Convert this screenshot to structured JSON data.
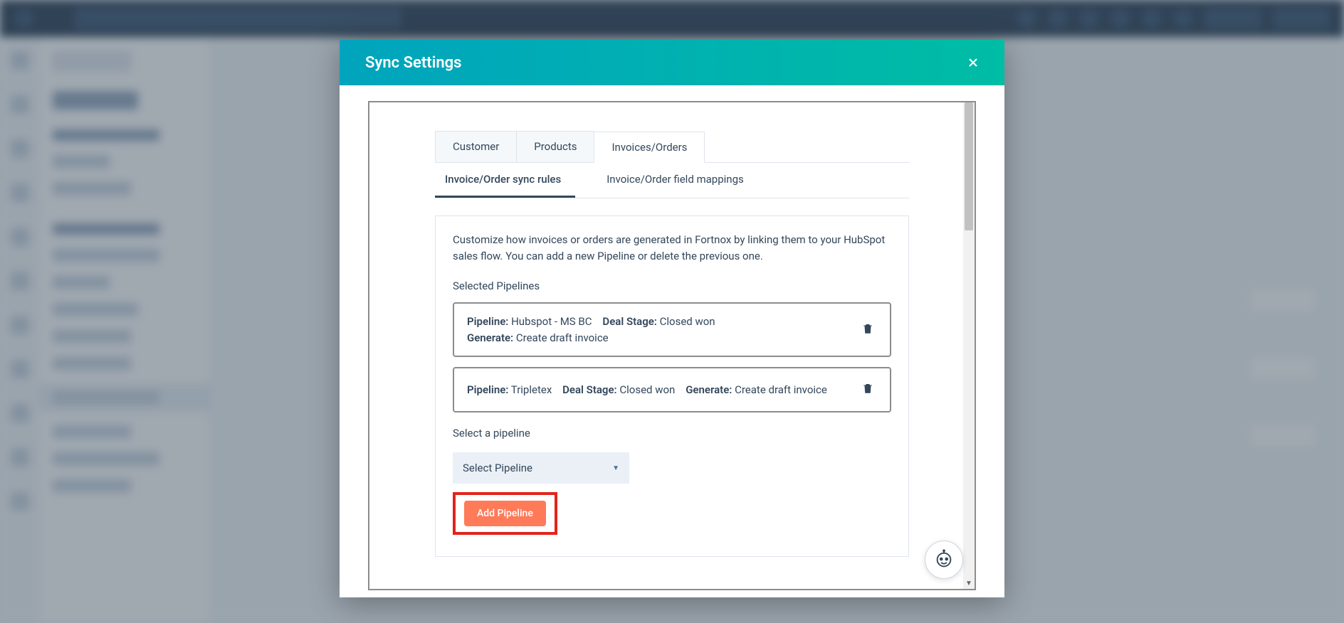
{
  "modal": {
    "title": "Sync Settings",
    "tabs_main": {
      "customer": "Customer",
      "products": "Products",
      "invoices": "Invoices/Orders"
    },
    "tabs_sub": {
      "sync_rules": "Invoice/Order sync rules",
      "field_mappings": "Invoice/Order field mappings"
    },
    "description": "Customize how invoices or orders are generated in Fortnox by linking them to your HubSpot sales flow. You can add a new Pipeline or delete the previous one.",
    "selected_label": "Selected Pipelines",
    "labels": {
      "pipeline": "Pipeline:",
      "deal_stage": "Deal Stage:",
      "generate": "Generate:"
    },
    "pipelines": [
      {
        "pipeline": "Hubspot - MS BC",
        "deal_stage": "Closed won",
        "generate": "Create draft invoice"
      },
      {
        "pipeline": "Tripletex",
        "deal_stage": "Closed won",
        "generate": "Create draft invoice"
      }
    ],
    "select_label": "Select a pipeline",
    "select_placeholder": "Select Pipeline",
    "add_button": "Add Pipeline"
  }
}
